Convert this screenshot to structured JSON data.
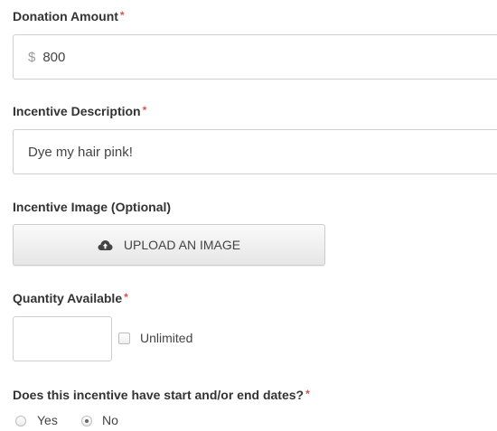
{
  "donation": {
    "label": "Donation Amount",
    "required": "*",
    "currency": "$",
    "value": "800"
  },
  "incentive_description": {
    "label": "Incentive Description",
    "required": "*",
    "value": "Dye my hair pink!"
  },
  "incentive_image": {
    "label": "Incentive Image (Optional)",
    "button_label": "UPLOAD AN IMAGE",
    "button_icon": "cloud-upload-icon"
  },
  "quantity": {
    "label": "Quantity Available",
    "required": "*",
    "value": "",
    "unlimited_label": "Unlimited",
    "unlimited_checked": false
  },
  "dates": {
    "label": "Does this incentive have start and/or end dates?",
    "required": "*",
    "options": [
      {
        "label": "Yes",
        "checked": false
      },
      {
        "label": "No",
        "checked": true
      }
    ]
  },
  "colors": {
    "required": "#d9534f",
    "text": "#333333",
    "border": "#cfcfcf"
  }
}
